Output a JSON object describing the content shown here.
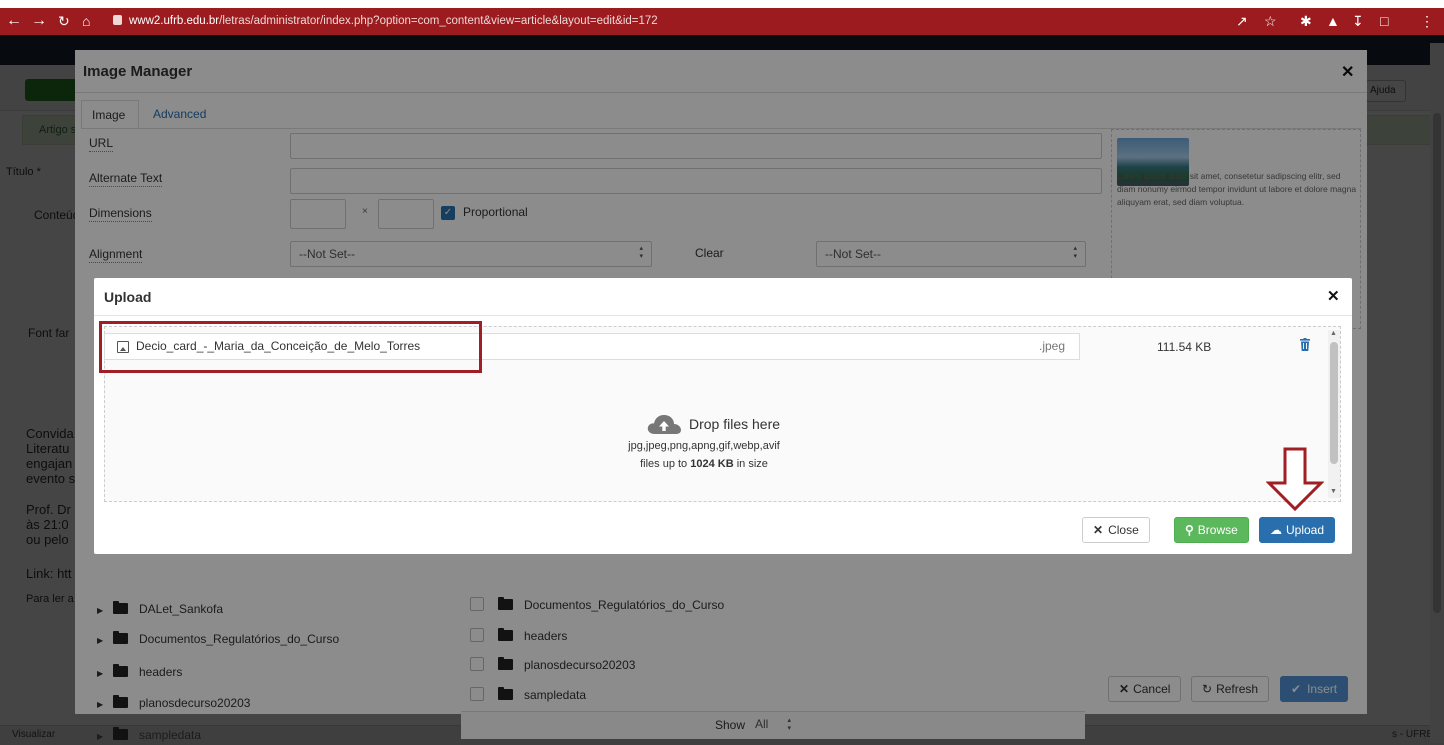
{
  "browser": {
    "url_domain": "www2.ufrb.edu.br",
    "url_path": "/letras/administrator/index.php?option=com_content&view=article&layout=edit&id=172"
  },
  "background": {
    "help": "Ajuda",
    "alert": "Artigo s",
    "title_label": "Título *",
    "tab_content": "Conteúd",
    "font_family": "Font far",
    "body_lines": [
      "Convida",
      "Literatu",
      "engajan",
      "evento s"
    ],
    "prof_lines": [
      "Prof. Dr",
      "às 21:0",
      "ou pelo"
    ],
    "link": "Link: htt",
    "read_more": "Para ler a",
    "status_left": "Visualizar",
    "status_right": "s - UFRB"
  },
  "image_manager": {
    "title": "Image Manager",
    "tabs": [
      "Image",
      "Advanced"
    ],
    "fields": {
      "url": "URL",
      "alt": "Alternate Text",
      "dimensions": "Dimensions",
      "proportional": "Proportional",
      "alignment": "Alignment",
      "alignment_value": "--Not Set--",
      "clear": "Clear",
      "clear_value": "--Not Set--"
    },
    "preview_text": "Lorem ipsum dolor sit amet, consetetur sadipscing elitr, sed diam nonumy eirmod tempor invidunt ut labore et dolore magna aliquyam erat, sed diam voluptua.",
    "tree": [
      "DALet_Sankofa",
      "Documentos_Regulatórios_do_Curso",
      "headers",
      "planosdecurso20203",
      "sampledata"
    ],
    "files": [
      "Documentos_Regulatórios_do_Curso",
      "headers",
      "planosdecurso20203",
      "sampledata"
    ],
    "show_label": "Show",
    "show_value": "All",
    "buttons": {
      "cancel": "Cancel",
      "refresh": "Refresh",
      "insert": "Insert"
    }
  },
  "upload": {
    "title": "Upload",
    "file": {
      "name": "Decio_card_-_Maria_da_Conceição_de_Melo_Torres",
      "ext": ".jpeg",
      "size": "111.54 KB"
    },
    "drop_label": "Drop files here",
    "types": "jpg,jpeg,png,apng,gif,webp,avif",
    "limit_prefix": "files up to ",
    "limit_value": "1024 KB",
    "limit_suffix": " in size",
    "buttons": {
      "close": "Close",
      "browse": "Browse",
      "upload": "Upload"
    }
  },
  "colors": {
    "chrome": "#9b1b1e",
    "annotation": "#a01f24",
    "primary": "#2a6fad",
    "success": "#5cb85c"
  }
}
